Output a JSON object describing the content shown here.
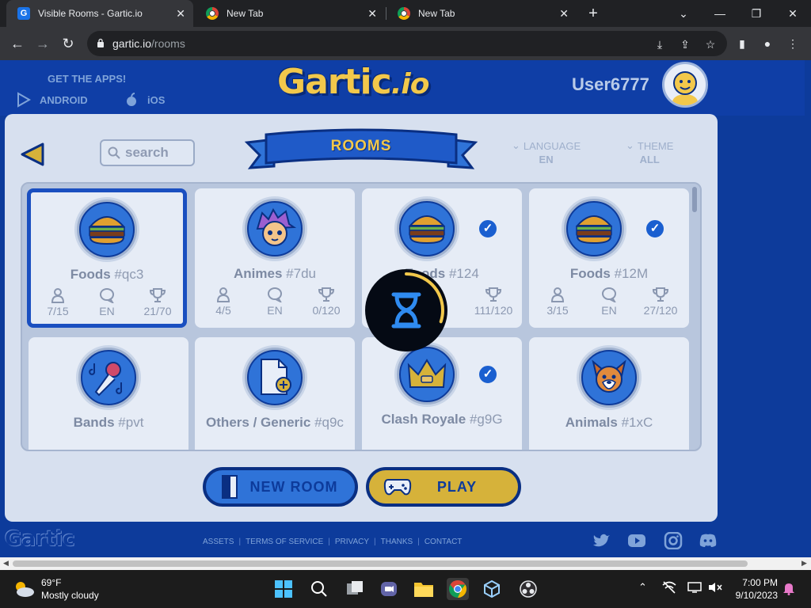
{
  "browser": {
    "tabs": [
      {
        "title": "Visible Rooms - Gartic.io",
        "favicon": "G"
      },
      {
        "title": "New Tab"
      },
      {
        "title": "New Tab"
      }
    ],
    "url_host": "gartic.io",
    "url_path": "/rooms"
  },
  "header": {
    "get_apps": "GET THE APPS!",
    "android": "ANDROID",
    "ios": "iOS",
    "logo_main": "Gartic",
    "logo_suffix": ".io",
    "username": "User6777"
  },
  "panel": {
    "search_placeholder": "search",
    "title": "ROOMS",
    "language_label": "LANGUAGE",
    "language_value": "EN",
    "theme_label": "THEME",
    "theme_value": "ALL"
  },
  "rooms": [
    {
      "name": "Foods",
      "code": "#qc3",
      "players": "7/15",
      "lang": "EN",
      "score": "21/70",
      "emblem": "burger-icon",
      "verified": false,
      "selected": true
    },
    {
      "name": "Animes",
      "code": "#7du",
      "players": "4/5",
      "lang": "EN",
      "score": "0/120",
      "emblem": "anime-face-icon",
      "verified": false,
      "selected": false
    },
    {
      "name": "Foods",
      "code": "#124",
      "players": "",
      "lang": "",
      "score": "111/120",
      "emblem": "burger-icon",
      "verified": true,
      "selected": false
    },
    {
      "name": "Foods",
      "code": "#12M",
      "players": "3/15",
      "lang": "EN",
      "score": "27/120",
      "emblem": "burger-icon",
      "verified": true,
      "selected": false
    },
    {
      "name": "Bands",
      "code": "#pvt",
      "emblem": "microphone-icon",
      "verified": false,
      "selected": false
    },
    {
      "name": "Others / Generic",
      "code": "#q9c",
      "emblem": "document-plus-icon",
      "verified": false,
      "selected": false
    },
    {
      "name": "Clash Royale",
      "code": "#g9G",
      "emblem": "crown-icon",
      "verified": true,
      "selected": false
    },
    {
      "name": "Animals",
      "code": "#1xC",
      "emblem": "dog-icon",
      "verified": false,
      "selected": false
    }
  ],
  "actions": {
    "new_room": "NEW ROOM",
    "play": "PLAY"
  },
  "footer": {
    "logo": "Gartic",
    "links": [
      "ASSETS",
      "TERMS OF SERVICE",
      "PRIVACY",
      "THANKS",
      "CONTACT"
    ]
  },
  "taskbar": {
    "temperature": "69°F",
    "condition": "Mostly cloudy",
    "time": "7:00 PM",
    "date": "9/10/2023"
  },
  "colors": {
    "page_blue": "#0d3b9b",
    "accent_yellow": "#f2c84b",
    "panel_bg": "#d7e0ef",
    "verified_blue": "#1a5fd0"
  },
  "loading_progress": 0.3
}
